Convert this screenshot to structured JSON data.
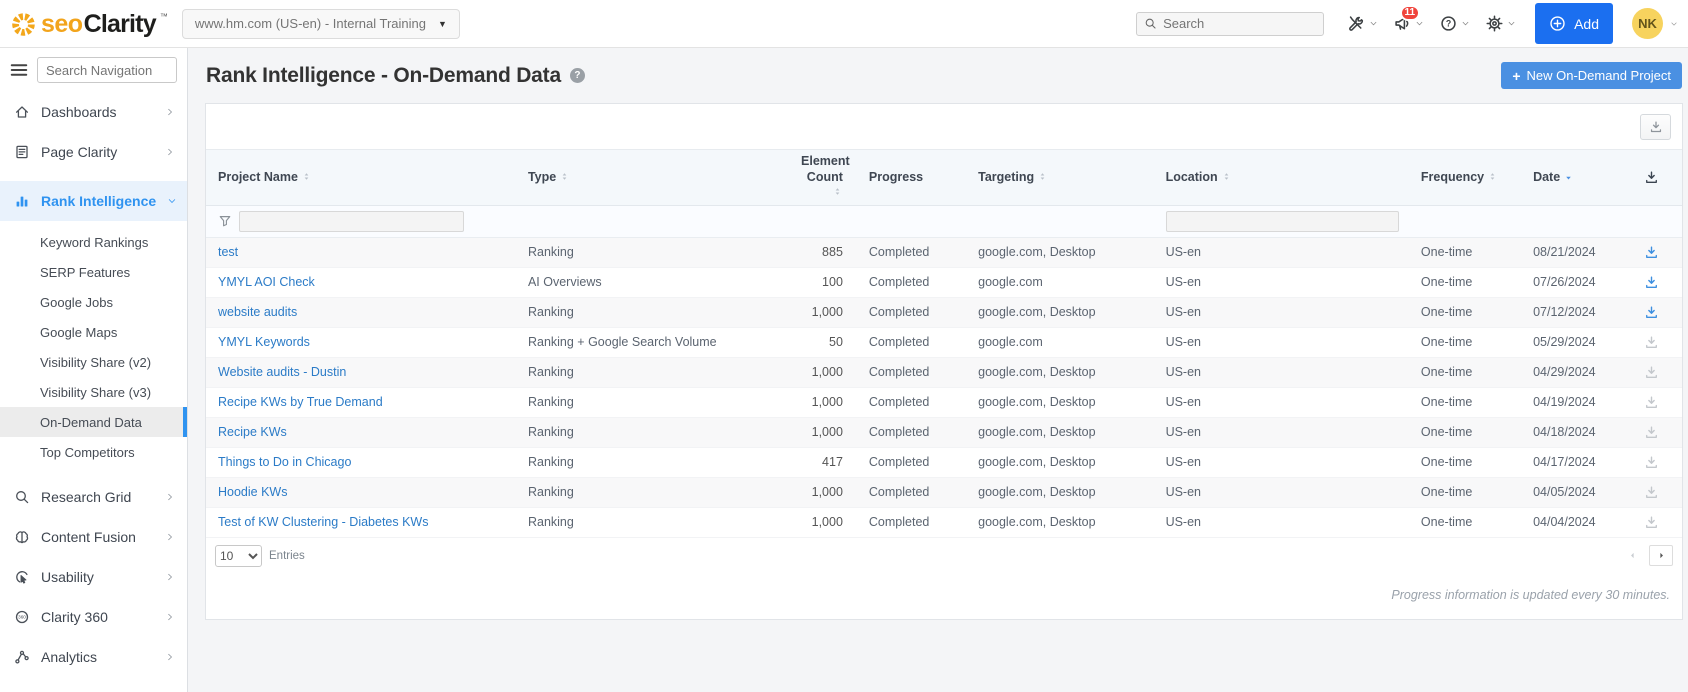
{
  "topbar": {
    "brand": {
      "seo": "seo",
      "clarity": "Clarity",
      "tm": "™"
    },
    "domain_selector": {
      "label": "www.hm.com (US-en) - Internal Training",
      "caret": "▼"
    },
    "search": {
      "placeholder": "Search"
    },
    "notification_count": "11",
    "add_label": "Add",
    "avatar_initials": "NK"
  },
  "sidebar": {
    "search_placeholder": "Search Navigation",
    "items": [
      {
        "label": "Dashboards",
        "icon": "home"
      },
      {
        "label": "Page Clarity",
        "icon": "document"
      },
      {
        "label": "Rank Intelligence",
        "icon": "bar-chart",
        "active": true,
        "expanded": true,
        "children": [
          {
            "label": "Keyword Rankings"
          },
          {
            "label": "SERP Features"
          },
          {
            "label": "Google Jobs"
          },
          {
            "label": "Google Maps"
          },
          {
            "label": "Visibility Share (v2)"
          },
          {
            "label": "Visibility Share (v3)"
          },
          {
            "label": "On-Demand Data",
            "selected": true
          },
          {
            "label": "Top Competitors"
          }
        ]
      },
      {
        "label": "Research Grid",
        "icon": "search"
      },
      {
        "label": "Content Fusion",
        "icon": "brain"
      },
      {
        "label": "Usability",
        "icon": "cursor"
      },
      {
        "label": "Clarity 360",
        "icon": "clarity-360"
      },
      {
        "label": "Analytics",
        "icon": "analytics"
      }
    ]
  },
  "page": {
    "title": "Rank Intelligence - On-Demand Data",
    "help_glyph": "?",
    "new_project_plus": "+",
    "new_project_label": "New On-Demand Project"
  },
  "table": {
    "columns": [
      {
        "label": "Project Name",
        "sort": "both"
      },
      {
        "label": "Type",
        "sort": "both"
      },
      {
        "label": "Element Count",
        "sort": "both",
        "align": "right"
      },
      {
        "label": "Progress",
        "sort": "none"
      },
      {
        "label": "Targeting",
        "sort": "both"
      },
      {
        "label": "Location",
        "sort": "both"
      },
      {
        "label": "Frequency",
        "sort": "both"
      },
      {
        "label": "Date",
        "sort": "desc"
      },
      {
        "label": "",
        "sort": "none",
        "icon": "download",
        "align": "center"
      }
    ],
    "rows": [
      {
        "name": "test",
        "type": "Ranking",
        "count": "885",
        "progress": "Completed",
        "targeting": "google.com, Desktop",
        "location": "US-en",
        "frequency": "One-time",
        "date": "08/21/2024",
        "download": "active"
      },
      {
        "name": "YMYL AOI Check",
        "type": "AI Overviews",
        "count": "100",
        "progress": "Completed",
        "targeting": "google.com",
        "location": "US-en",
        "frequency": "One-time",
        "date": "07/26/2024",
        "download": "active"
      },
      {
        "name": "website audits",
        "type": "Ranking",
        "count": "1,000",
        "progress": "Completed",
        "targeting": "google.com, Desktop",
        "location": "US-en",
        "frequency": "One-time",
        "date": "07/12/2024",
        "download": "active"
      },
      {
        "name": "YMYL Keywords",
        "type": "Ranking + Google Search Volume",
        "count": "50",
        "progress": "Completed",
        "targeting": "google.com",
        "location": "US-en",
        "frequency": "One-time",
        "date": "05/29/2024",
        "download": "inactive"
      },
      {
        "name": "Website audits - Dustin",
        "type": "Ranking",
        "count": "1,000",
        "progress": "Completed",
        "targeting": "google.com, Desktop",
        "location": "US-en",
        "frequency": "One-time",
        "date": "04/29/2024",
        "download": "inactive"
      },
      {
        "name": "Recipe KWs by True Demand",
        "type": "Ranking",
        "count": "1,000",
        "progress": "Completed",
        "targeting": "google.com, Desktop",
        "location": "US-en",
        "frequency": "One-time",
        "date": "04/19/2024",
        "download": "inactive"
      },
      {
        "name": "Recipe KWs",
        "type": "Ranking",
        "count": "1,000",
        "progress": "Completed",
        "targeting": "google.com, Desktop",
        "location": "US-en",
        "frequency": "One-time",
        "date": "04/18/2024",
        "download": "inactive"
      },
      {
        "name": "Things to Do in Chicago",
        "type": "Ranking",
        "count": "417",
        "progress": "Completed",
        "targeting": "google.com, Desktop",
        "location": "US-en",
        "frequency": "One-time",
        "date": "04/17/2024",
        "download": "inactive"
      },
      {
        "name": "Hoodie KWs",
        "type": "Ranking",
        "count": "1,000",
        "progress": "Completed",
        "targeting": "google.com, Desktop",
        "location": "US-en",
        "frequency": "One-time",
        "date": "04/05/2024",
        "download": "inactive"
      },
      {
        "name": "Test of KW Clustering - Diabetes KWs",
        "type": "Ranking",
        "count": "1,000",
        "progress": "Completed",
        "targeting": "google.com, Desktop",
        "location": "US-en",
        "frequency": "One-time",
        "date": "04/04/2024",
        "download": "inactive"
      }
    ],
    "entries_per_page": "10",
    "entries_label": "Entries",
    "footnote": "Progress information is updated every 30 minutes."
  },
  "colors": {
    "brand_gold": "#f2a41c",
    "add_button_blue": "#1b6ff0",
    "new_project_blue": "#4a90e2",
    "link_blue": "#2b7bc7",
    "active_nav_blue": "#2f93f0",
    "badge_red": "#f0443c",
    "download_active": "#3d8fe0",
    "download_inactive": "#c3c7cc"
  }
}
